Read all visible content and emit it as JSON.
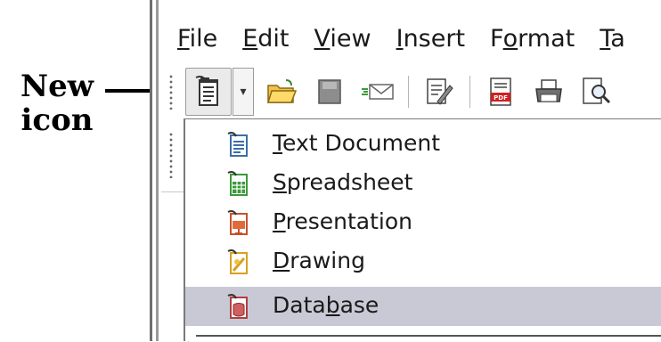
{
  "annotation": {
    "line1": "New",
    "line2": "icon"
  },
  "menubar": {
    "items": [
      {
        "pre": "",
        "mn": "F",
        "post": "ile"
      },
      {
        "pre": "",
        "mn": "E",
        "post": "dit"
      },
      {
        "pre": "",
        "mn": "V",
        "post": "iew"
      },
      {
        "pre": "",
        "mn": "I",
        "post": "nsert"
      },
      {
        "pre": "F",
        "mn": "o",
        "post": "rmat"
      },
      {
        "pre": "",
        "mn": "T",
        "post": "a"
      }
    ]
  },
  "toolbar": {
    "icons": [
      "new-document-icon",
      "dropdown-arrow-icon",
      "open-folder-icon",
      "save-icon",
      "email-icon",
      "edit-file-icon",
      "export-pdf-icon",
      "print-icon",
      "page-preview-icon"
    ]
  },
  "new_menu": {
    "items": [
      {
        "pre": "",
        "mn": "T",
        "post": "ext Document",
        "icon": "text-document-icon",
        "color": "#3b6fa8"
      },
      {
        "pre": "",
        "mn": "S",
        "post": "preadsheet",
        "icon": "spreadsheet-icon",
        "color": "#3a9a3a"
      },
      {
        "pre": "",
        "mn": "P",
        "post": "resentation",
        "icon": "presentation-icon",
        "color": "#c8502a"
      },
      {
        "pre": "",
        "mn": "D",
        "post": "rawing",
        "icon": "drawing-icon",
        "color": "#d8a020"
      },
      {
        "pre": "Data",
        "mn": "b",
        "post": "ase",
        "icon": "database-icon",
        "color": "#b04040"
      }
    ],
    "selected_index": 4
  }
}
